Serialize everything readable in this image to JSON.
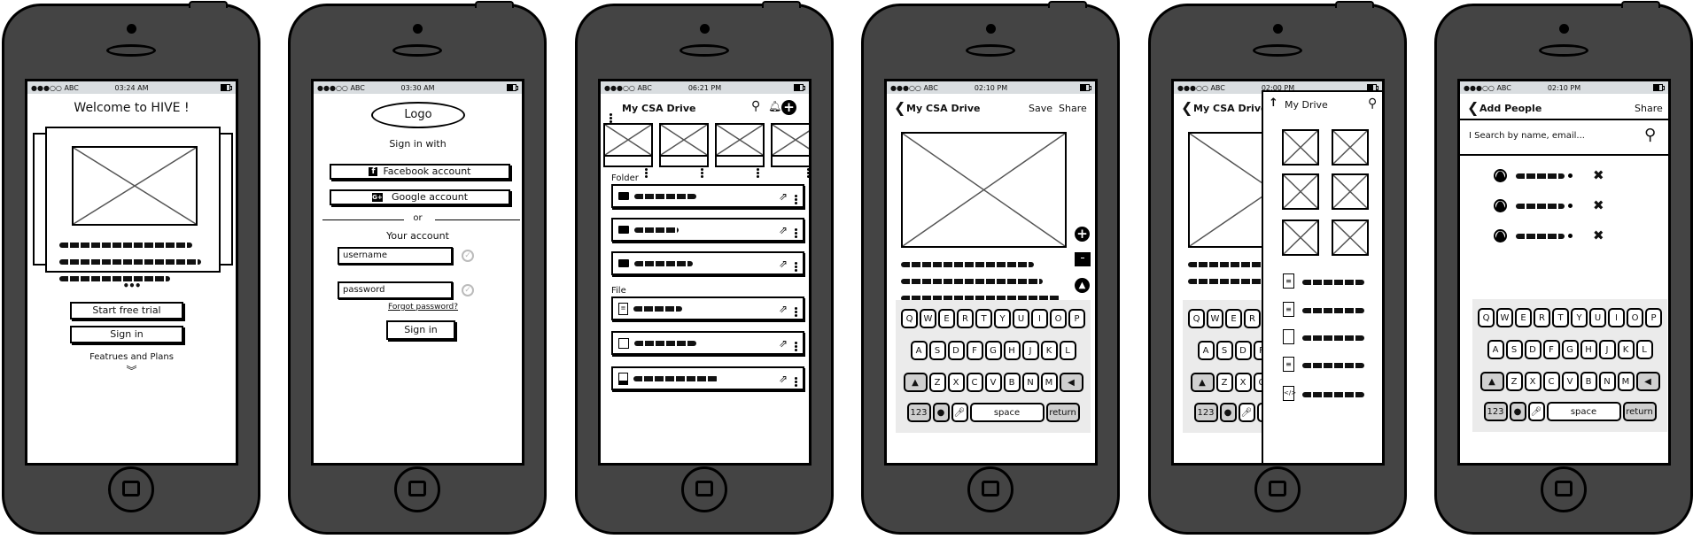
{
  "statusbar": {
    "carrier": "●●●○○ ABC"
  },
  "phones": [
    {
      "time": "03:24 AM",
      "title": "Welcome to HIVE !",
      "pager_dots": "•••",
      "start_trial_label": "Start free trial",
      "sign_in_label": "Sign in",
      "features_label": "Featrues and Plans",
      "chevron": "︾"
    },
    {
      "time": "03:30 AM",
      "logo_label": "Logo",
      "sign_in_with": "Sign in with",
      "facebook_label": "Facebook account",
      "google_label": "Google account",
      "divider_label": "or",
      "your_account": "Your account",
      "username_value": "username",
      "password_value": "password",
      "forgot_label": "Forgot password?",
      "sign_in_label": "Sign in"
    },
    {
      "time": "06:21 PM",
      "title": "My CSA Drive",
      "folder_heading": "Folder",
      "file_heading": "File",
      "folders": [
        {
          "icon": "folder-icon"
        },
        {
          "icon": "folder-icon"
        },
        {
          "icon": "folder-icon"
        }
      ],
      "files": [
        {
          "icon": "document-icon"
        },
        {
          "icon": "note-icon"
        },
        {
          "icon": "image-file-icon"
        }
      ]
    },
    {
      "time": "02:10 PM",
      "title": "My CSA Drive",
      "save_label": "Save",
      "share_label": "Share"
    },
    {
      "time": "02:00 PM",
      "title": "My CSA Drive",
      "panel_title": "My Drive",
      "files": [
        {
          "icon": "document-icon"
        },
        {
          "icon": "document-icon"
        },
        {
          "icon": "blank-file-icon"
        },
        {
          "icon": "document-icon"
        },
        {
          "icon": "code-file-icon"
        }
      ]
    },
    {
      "time": "02:10 PM",
      "title": "Add People",
      "share_label": "Share",
      "search_placeholder": "I Search by name, email...",
      "people_count": 3
    }
  ],
  "keyboard": {
    "row1": [
      "Q",
      "W",
      "E",
      "R",
      "T",
      "Y",
      "U",
      "I",
      "O",
      "P"
    ],
    "row2": [
      "A",
      "S",
      "D",
      "F",
      "G",
      "H",
      "J",
      "K",
      "L"
    ],
    "row3": [
      "Z",
      "X",
      "C",
      "V",
      "B",
      "N",
      "M"
    ],
    "num_label": "123",
    "space_label": "space",
    "return_label": "return"
  }
}
